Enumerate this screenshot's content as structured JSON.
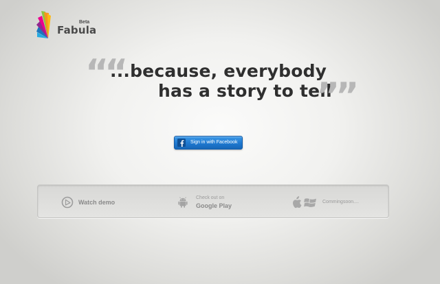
{
  "brand": {
    "name": "Fabula",
    "badge": "Beta"
  },
  "tagline": {
    "open_quote": "““",
    "line1": "...because, everybody",
    "line2": "has a story to tell",
    "close_quote": "””"
  },
  "auth": {
    "facebook_label": "Sign in with Facebook",
    "facebook_icon": "facebook-icon"
  },
  "panel": {
    "demo": {
      "label": "Watch demo",
      "icon": "play-icon"
    },
    "google_play": {
      "small_label": "Check out on",
      "label": "Google Play",
      "icon": "android-icon"
    },
    "coming_soon": {
      "label": "Commingsoon....",
      "icons": [
        "apple-icon",
        "windows-icon"
      ]
    }
  },
  "colors": {
    "facebook_blue": "#1f78cf",
    "headline": "#2f2f2f",
    "quote_gray": "#b7b7b7"
  }
}
